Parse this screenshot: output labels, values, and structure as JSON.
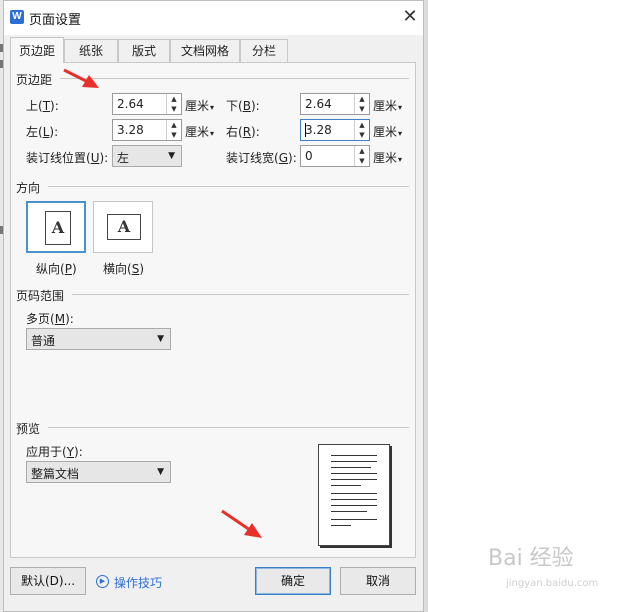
{
  "window": {
    "title": "页面设置",
    "app_icon": "W"
  },
  "tabs": [
    {
      "label": "页边距",
      "active": true
    },
    {
      "label": "纸张",
      "active": false
    },
    {
      "label": "版式",
      "active": false
    },
    {
      "label": "文档网格",
      "active": false
    },
    {
      "label": "分栏",
      "active": false
    }
  ],
  "margins": {
    "section_title": "页边距",
    "top": {
      "label": "上",
      "key": "T",
      "value": "2.64",
      "unit": "厘米"
    },
    "bottom": {
      "label": "下",
      "key": "B",
      "value": "2.64",
      "unit": "厘米"
    },
    "left": {
      "label": "左",
      "key": "L",
      "value": "3.28",
      "unit": "厘米"
    },
    "right": {
      "label": "右",
      "key": "R",
      "value": "3.28",
      "unit": "厘米"
    },
    "gutter_pos": {
      "label": "装订线位置",
      "key": "U",
      "value": "左"
    },
    "gutter": {
      "label": "装订线宽",
      "key": "G",
      "value": "0",
      "unit": "厘米"
    }
  },
  "orientation": {
    "section_title": "方向",
    "portrait": {
      "label": "纵向",
      "key": "P",
      "glyph": "A",
      "selected": true
    },
    "landscape": {
      "label": "横向",
      "key": "S",
      "glyph": "A",
      "selected": false
    }
  },
  "page_range": {
    "section_title": "页码范围",
    "multi_label": "多页",
    "multi_key": "M",
    "multi_value": "普通"
  },
  "preview": {
    "section_title": "预览",
    "apply_label": "应用于",
    "apply_key": "Y",
    "apply_value": "整篇文档"
  },
  "buttons": {
    "default": "默认(D)...",
    "tips": "操作技巧",
    "ok": "确定",
    "cancel": "取消"
  },
  "watermark": {
    "text": "Bai 经验",
    "sub": "jingyan.baidu.com"
  },
  "colors": {
    "accent": "#3b7fc4",
    "link": "#2f6fd1",
    "annotation_arrow": "#e8302a"
  }
}
